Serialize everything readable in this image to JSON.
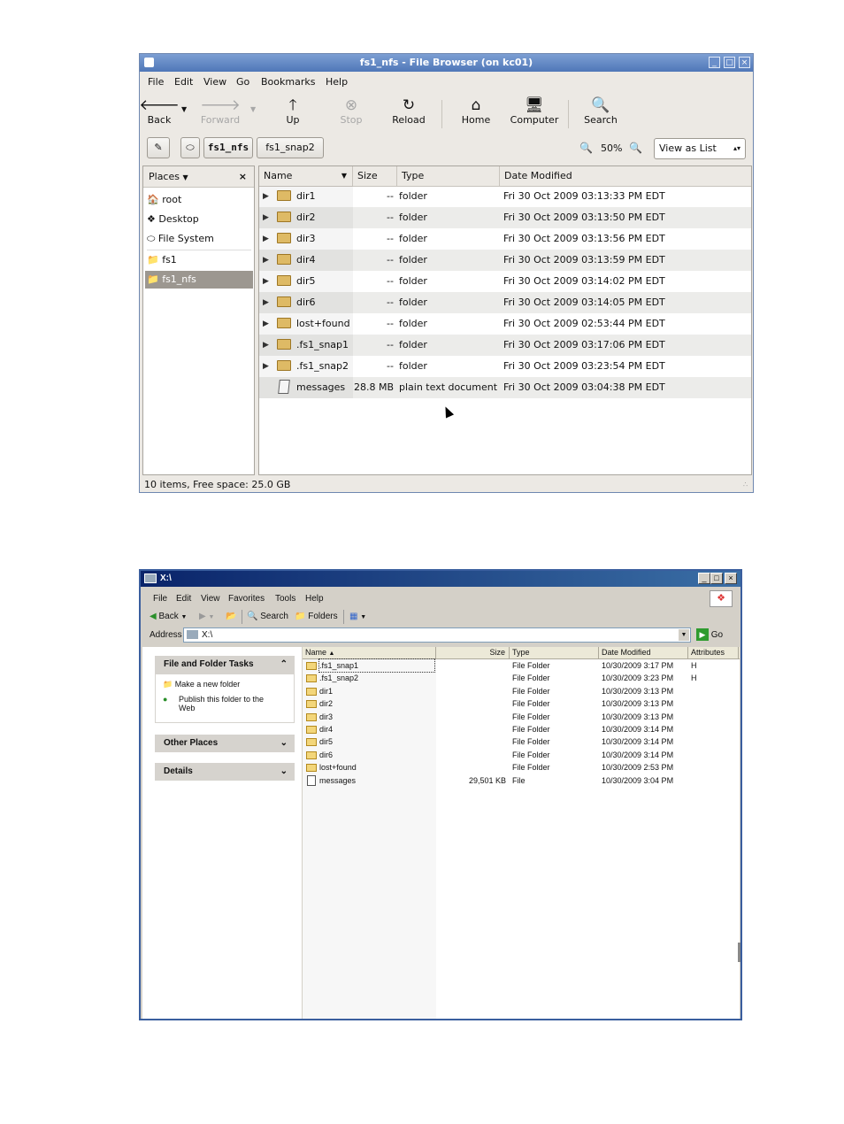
{
  "gnome": {
    "title": "fs1_nfs - File Browser (on kc01)",
    "menu": [
      "File",
      "Edit",
      "View",
      "Go",
      "Bookmarks",
      "Help"
    ],
    "toolbar": {
      "back": "Back",
      "forward": "Forward",
      "up": "Up",
      "stop": "Stop",
      "reload": "Reload",
      "home": "Home",
      "computer": "Computer",
      "search": "Search"
    },
    "path_buttons": [
      "fs1_nfs",
      "fs1_snap2"
    ],
    "zoom": "50%",
    "view_mode": "View as List",
    "places_label": "Places",
    "places": [
      "root",
      "Desktop",
      "File System",
      "fs1",
      "fs1_nfs"
    ],
    "columns": [
      "Name",
      "Size",
      "Type",
      "Date Modified"
    ],
    "files": [
      {
        "name": "dir1",
        "size": "--",
        "type": "folder",
        "date": "Fri 30 Oct 2009 03:13:33 PM EDT"
      },
      {
        "name": "dir2",
        "size": "--",
        "type": "folder",
        "date": "Fri 30 Oct 2009 03:13:50 PM EDT"
      },
      {
        "name": "dir3",
        "size": "--",
        "type": "folder",
        "date": "Fri 30 Oct 2009 03:13:56 PM EDT"
      },
      {
        "name": "dir4",
        "size": "--",
        "type": "folder",
        "date": "Fri 30 Oct 2009 03:13:59 PM EDT"
      },
      {
        "name": "dir5",
        "size": "--",
        "type": "folder",
        "date": "Fri 30 Oct 2009 03:14:02 PM EDT"
      },
      {
        "name": "dir6",
        "size": "--",
        "type": "folder",
        "date": "Fri 30 Oct 2009 03:14:05 PM EDT"
      },
      {
        "name": "lost+found",
        "size": "--",
        "type": "folder",
        "date": "Fri 30 Oct 2009 02:53:44 PM EDT"
      },
      {
        "name": ".fs1_snap1",
        "size": "--",
        "type": "folder",
        "date": "Fri 30 Oct 2009 03:17:06 PM EDT"
      },
      {
        "name": ".fs1_snap2",
        "size": "--",
        "type": "folder",
        "date": "Fri 30 Oct 2009 03:23:54 PM EDT"
      },
      {
        "name": "messages",
        "size": "28.8 MB",
        "type": "plain text document",
        "date": "Fri 30 Oct 2009 03:04:38 PM EDT"
      }
    ],
    "status": "10 items, Free space: 25.0 GB"
  },
  "xp": {
    "title": "X:\\",
    "menu": [
      "File",
      "Edit",
      "View",
      "Favorites",
      "Tools",
      "Help"
    ],
    "toolbar": {
      "back": "Back",
      "search": "Search",
      "folders": "Folders"
    },
    "address_label": "Address",
    "address": "X:\\",
    "go": "Go",
    "tasks": {
      "file_folder_tasks": "File and Folder Tasks",
      "make_folder": "Make a new folder",
      "publish": "Publish this folder to the Web",
      "other_places": "Other Places",
      "details": "Details"
    },
    "columns": [
      "Name",
      "Size",
      "Type",
      "Date Modified",
      "Attributes"
    ],
    "files": [
      {
        "name": ".fs1_snap1",
        "size": "",
        "type": "File Folder",
        "date": "10/30/2009 3:17 PM",
        "attr": "H"
      },
      {
        "name": ".fs1_snap2",
        "size": "",
        "type": "File Folder",
        "date": "10/30/2009 3:23 PM",
        "attr": "H"
      },
      {
        "name": "dir1",
        "size": "",
        "type": "File Folder",
        "date": "10/30/2009 3:13 PM",
        "attr": ""
      },
      {
        "name": "dir2",
        "size": "",
        "type": "File Folder",
        "date": "10/30/2009 3:13 PM",
        "attr": ""
      },
      {
        "name": "dir3",
        "size": "",
        "type": "File Folder",
        "date": "10/30/2009 3:13 PM",
        "attr": ""
      },
      {
        "name": "dir4",
        "size": "",
        "type": "File Folder",
        "date": "10/30/2009 3:14 PM",
        "attr": ""
      },
      {
        "name": "dir5",
        "size": "",
        "type": "File Folder",
        "date": "10/30/2009 3:14 PM",
        "attr": ""
      },
      {
        "name": "dir6",
        "size": "",
        "type": "File Folder",
        "date": "10/30/2009 3:14 PM",
        "attr": ""
      },
      {
        "name": "lost+found",
        "size": "",
        "type": "File Folder",
        "date": "10/30/2009 2:53 PM",
        "attr": ""
      },
      {
        "name": "messages",
        "size": "29,501 KB",
        "type": "File",
        "date": "10/30/2009 3:04 PM",
        "attr": ""
      }
    ]
  }
}
